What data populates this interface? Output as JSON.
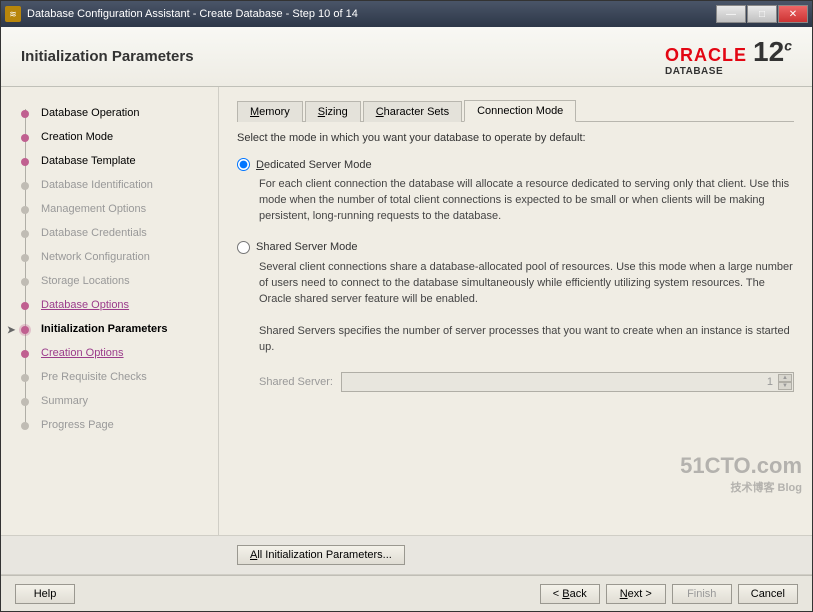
{
  "titlebar": {
    "text": "Database Configuration Assistant - Create Database - Step 10 of 14"
  },
  "header": {
    "title": "Initialization Parameters",
    "brand": "ORACLE",
    "brand_sub": "DATABASE",
    "version": "12",
    "version_suffix": "c"
  },
  "sidebar": {
    "steps": [
      {
        "label": "Database Operation",
        "state": "done"
      },
      {
        "label": "Creation Mode",
        "state": "done"
      },
      {
        "label": "Database Template",
        "state": "done"
      },
      {
        "label": "Database Identification",
        "state": "disabled"
      },
      {
        "label": "Management Options",
        "state": "disabled"
      },
      {
        "label": "Database Credentials",
        "state": "disabled"
      },
      {
        "label": "Network Configuration",
        "state": "disabled"
      },
      {
        "label": "Storage Locations",
        "state": "disabled"
      },
      {
        "label": "Database Options",
        "state": "link"
      },
      {
        "label": "Initialization Parameters",
        "state": "current"
      },
      {
        "label": "Creation Options",
        "state": "link"
      },
      {
        "label": "Pre Requisite Checks",
        "state": "disabled"
      },
      {
        "label": "Summary",
        "state": "disabled"
      },
      {
        "label": "Progress Page",
        "state": "disabled"
      }
    ]
  },
  "tabs": {
    "items": [
      {
        "prefix": "M",
        "rest": "emory"
      },
      {
        "prefix": "S",
        "rest": "izing"
      },
      {
        "prefix": "C",
        "rest": "haracter Sets"
      },
      {
        "prefix": "",
        "rest": "Connection Mode"
      }
    ],
    "active_index": 3
  },
  "content": {
    "instruction": "Select the mode in which you want your database to operate by default:",
    "opt1": {
      "label_u": "D",
      "label_rest": "edicated Server Mode",
      "desc": "For each client connection the database will allocate a resource dedicated to serving only that client.  Use this mode when the number of total client connections is expected to be small or when clients will be making persistent, long-running requests to the database."
    },
    "opt2": {
      "label_u": "",
      "label_rest": "Shared Server Mode",
      "desc1": "Several client connections share a database-allocated pool of resources.  Use this mode when a large number of users need to connect to the database simultaneously while efficiently utilizing system resources.  The Oracle shared server feature will be enabled.",
      "desc2": "Shared Servers specifies the number of server processes that you want to create when an instance is started up."
    },
    "shared_label": "Shared Server:",
    "shared_value": "1"
  },
  "footer_content": {
    "all_params": "All Initialization Parameters..."
  },
  "footer": {
    "help": "Help",
    "back": "< Back",
    "next": "Next >",
    "finish": "Finish",
    "cancel": "Cancel"
  }
}
